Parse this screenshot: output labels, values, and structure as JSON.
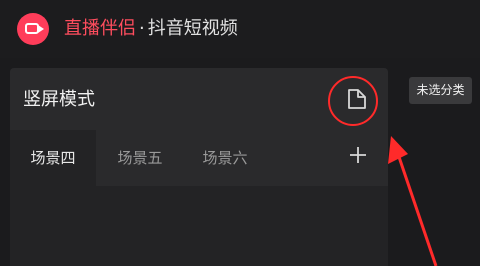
{
  "app": {
    "brand": "直播伴侣",
    "separator": "·",
    "subtitle": "抖音短视频",
    "brand_color": "#ff4d5e"
  },
  "panel": {
    "mode_title": "竖屏模式",
    "file_icon": "file-icon",
    "tabs": [
      {
        "label": "场景四",
        "active": true
      },
      {
        "label": "场景五",
        "active": false
      },
      {
        "label": "场景六",
        "active": false
      }
    ],
    "add_icon": "plus-icon"
  },
  "category_tag": "未选分类",
  "annotation": {
    "color": "#ff2a2a"
  }
}
